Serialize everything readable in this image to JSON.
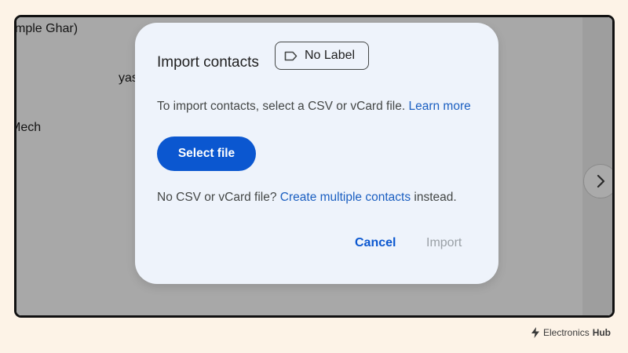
{
  "background": {
    "snippets": [
      "mple Ghar)",
      "yas",
      "Mech"
    ]
  },
  "dialog": {
    "title": "Import contacts",
    "label_chip": {
      "icon": "label-icon",
      "text": "No Label"
    },
    "description": {
      "text": "To import contacts, select a CSV or vCard file.",
      "link": "Learn more"
    },
    "select_file_button": "Select file",
    "no_csv": {
      "prefix": "No CSV or vCard file?",
      "link": "Create multiple contacts",
      "suffix": "instead."
    },
    "cancel_button": "Cancel",
    "import_button": "Import"
  },
  "next_button": {
    "icon": "chevron-right-icon"
  },
  "watermark": {
    "icon": "lightning-logo-icon",
    "brand_light": "Electronics",
    "brand_bold": "Hub"
  },
  "colors": {
    "page_bg": "#fdf3e7",
    "dialog_bg": "#eef3fb",
    "primary": "#0b57d0",
    "link": "#1b5fc1",
    "disabled": "#9aa0a6"
  }
}
